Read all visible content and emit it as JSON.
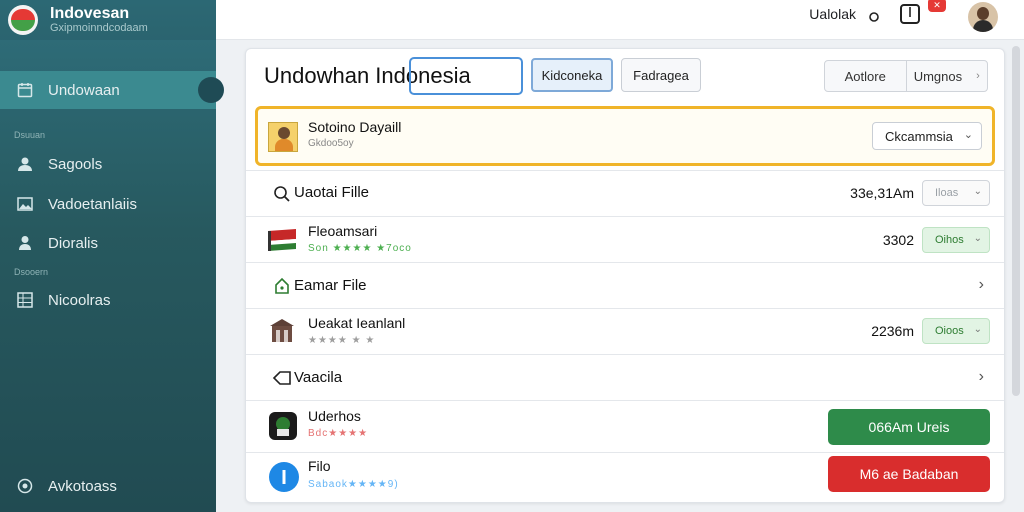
{
  "brand": {
    "title": "Indovesan",
    "subtitle": "Gxipmoinndcodaam"
  },
  "sidebar": {
    "items": [
      {
        "label": "Undowaan",
        "icon": "calendar-icon",
        "active": true
      },
      {
        "label": "Sagools",
        "icon": "users-icon"
      },
      {
        "label": "Vadoetanlaiis",
        "icon": "image-icon"
      },
      {
        "label": "Dioralis",
        "icon": "person-icon"
      },
      {
        "label": "Nicoolras",
        "icon": "grid-icon"
      },
      {
        "label": "Avkotoass",
        "icon": "settings-icon"
      }
    ],
    "section_labels": [
      "Dsuuan",
      "Dsooern"
    ]
  },
  "topbar": {
    "user_label": "Ualolak",
    "search_icon": "search-icon",
    "notification_icon": "bell-icon",
    "badge": "✕"
  },
  "main": {
    "title": "Undowhan Indonesia",
    "tabs": [
      {
        "label": "Kidconeka",
        "active": true
      },
      {
        "label": "Fadragea"
      }
    ],
    "segment": [
      "Aotlore",
      "Umgnos"
    ],
    "highlight": {
      "title": "Sotoino Dayaill",
      "subtitle": "Gkdoo5oy",
      "dropdown": "Ckcammsia"
    },
    "rows": [
      {
        "label": "Uaotai Fille",
        "value": "33e,31Am",
        "select": "Iloas"
      },
      {
        "label": "Fleoamsari",
        "sub": "Son ★★★★ ★7oco",
        "value": "3302",
        "select": "Oihos"
      },
      {
        "label": "Eamar File"
      },
      {
        "label": "Ueakat Ieanlanl",
        "sub": "★★★★ ★ ★",
        "value": "2236m",
        "select": "Oioos"
      },
      {
        "label": "Vaacila"
      },
      {
        "label": "Uderhos",
        "sub": "Bdc★★★★",
        "action": "066Am Ureis"
      },
      {
        "label": "Filo",
        "sub": "Sabaok★★★★9)",
        "action": "M6 ae Badaban"
      }
    ]
  },
  "colors": {
    "sidebar": "#27595f",
    "highlight_border": "#f0b429",
    "green": "#2e8b4a",
    "red": "#d92d2d",
    "accent": "#4a90d9"
  }
}
